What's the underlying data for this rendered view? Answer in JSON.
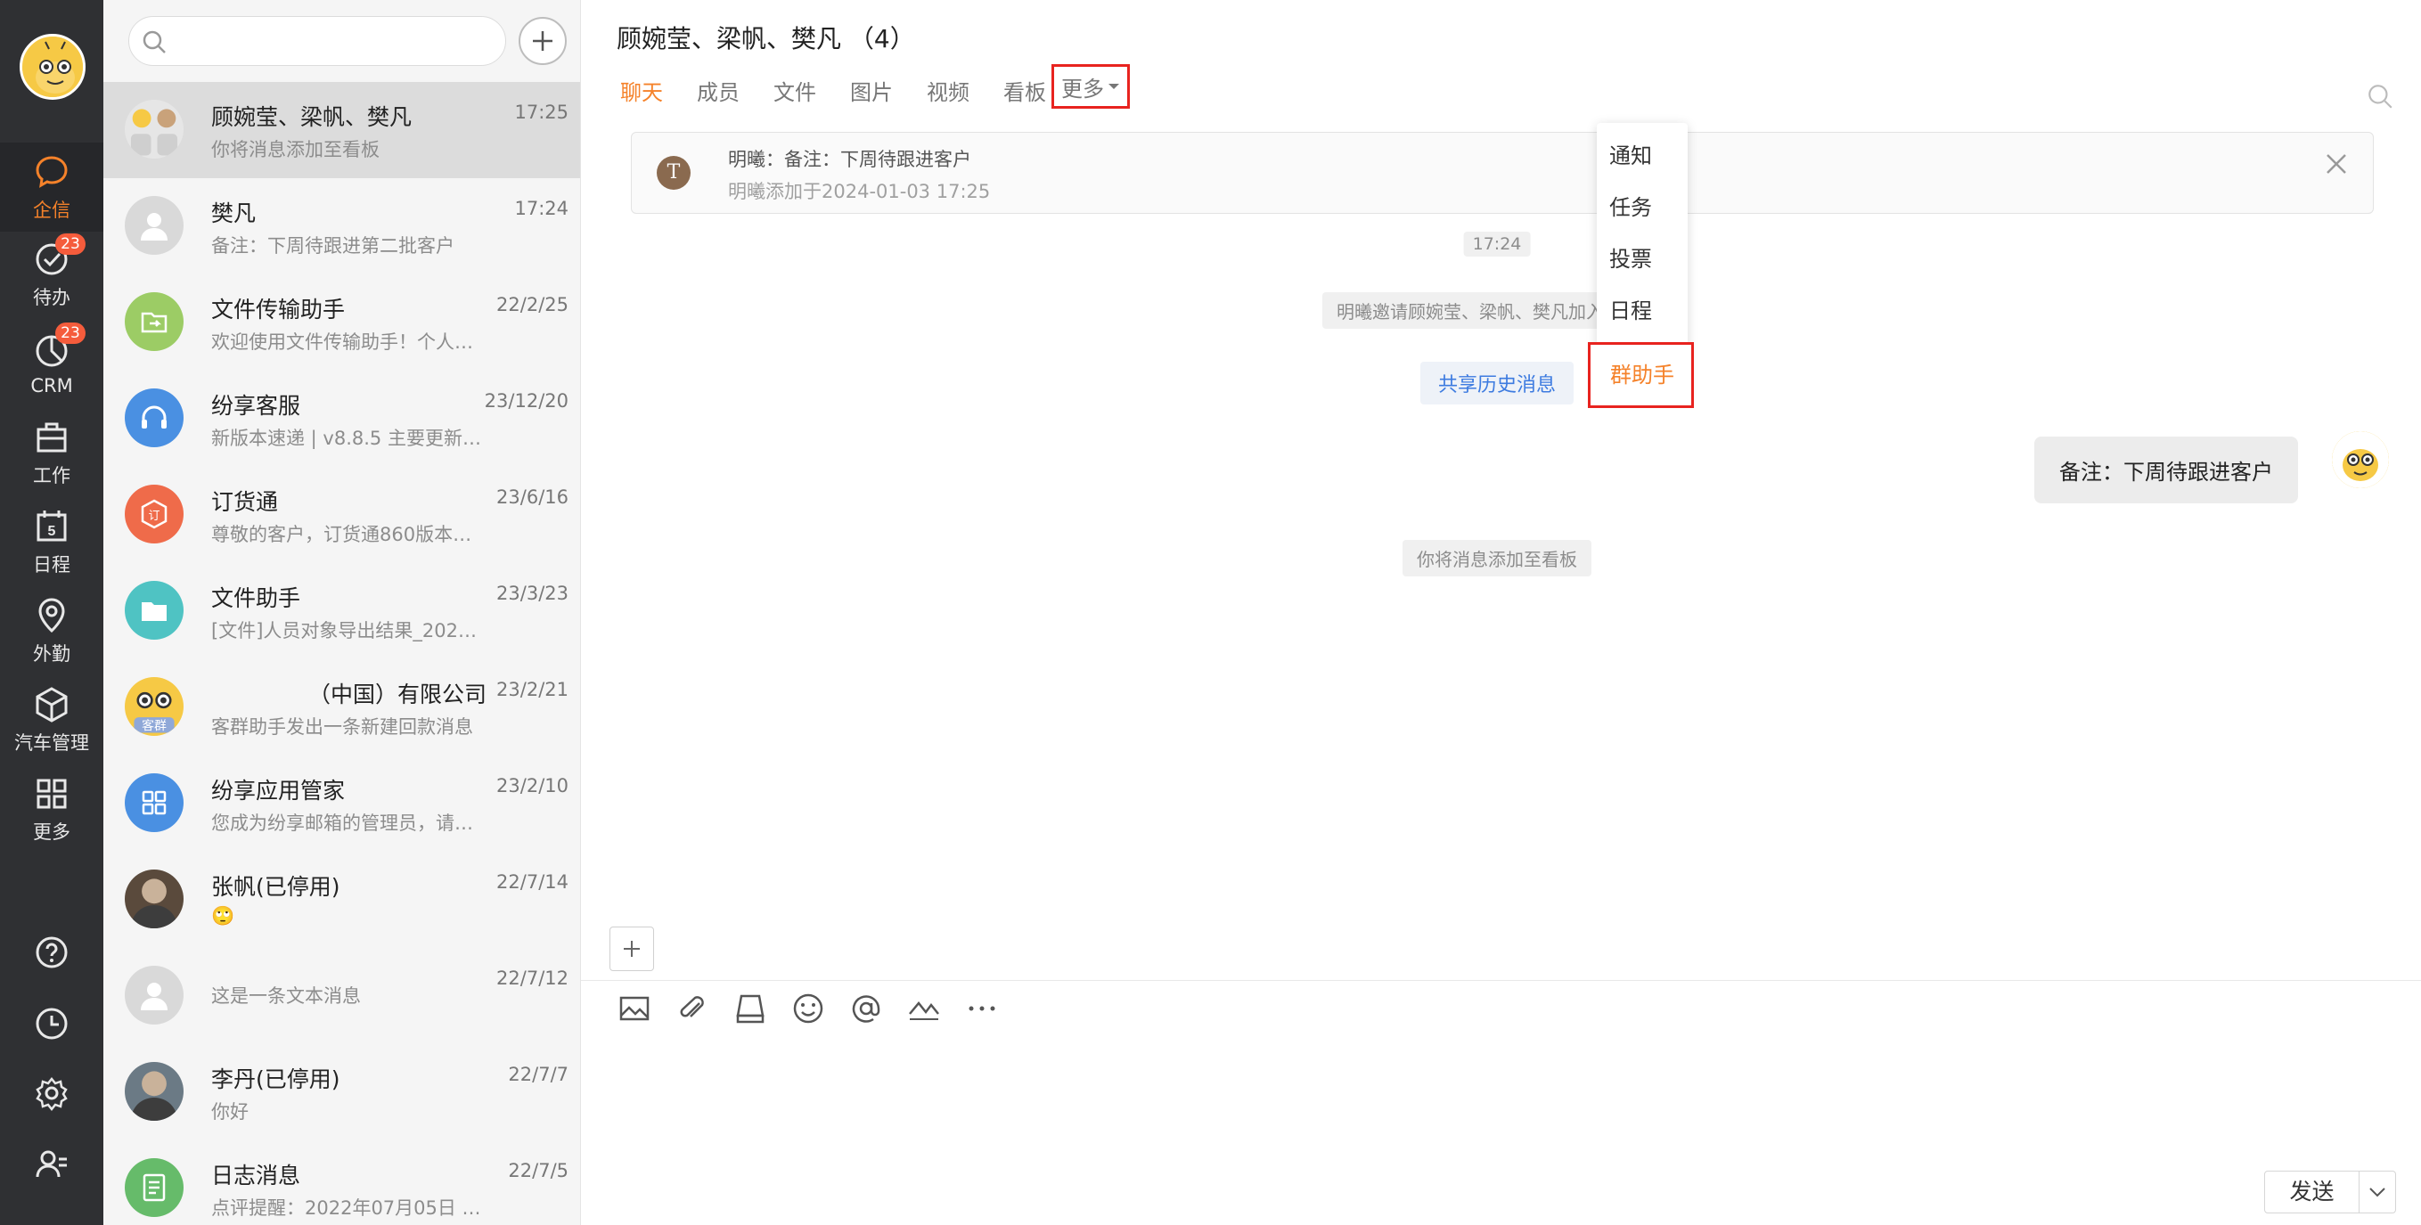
{
  "nav": {
    "items": [
      {
        "label": "企信",
        "icon": "chat-bubble-icon",
        "active": true
      },
      {
        "label": "待办",
        "icon": "check-circle-icon",
        "badge": "23"
      },
      {
        "label": "CRM",
        "icon": "pie-chart-icon",
        "badge": "23"
      },
      {
        "label": "工作",
        "icon": "briefcase-icon"
      },
      {
        "label": "日程",
        "icon": "calendar-icon",
        "day": "5"
      },
      {
        "label": "外勤",
        "icon": "location-pin-icon"
      },
      {
        "label": "汽车管理",
        "icon": "cube-icon"
      },
      {
        "label": "更多",
        "icon": "grid-icon"
      }
    ],
    "bottom_icons": [
      "help-icon",
      "clock-icon",
      "settings-icon",
      "contacts-icon"
    ]
  },
  "search": {
    "placeholder": ""
  },
  "conversations": [
    {
      "name": "顾婉莹、梁帆、樊凡",
      "time": "17:25",
      "preview": "你将消息添加至看板",
      "avatar": "group-avatar",
      "color": "#e6e6e6"
    },
    {
      "name": "樊凡",
      "time": "17:24",
      "preview": "备注：下周待跟进第二批客户",
      "avatar": "default-user-avatar",
      "color": "#d9d9d9"
    },
    {
      "name": "文件传输助手",
      "time": "22/2/25",
      "preview": "欢迎使用文件传输助手！个人…",
      "avatar": "file-transfer-icon",
      "color": "#9ccc65"
    },
    {
      "name": "纷享客服",
      "time": "23/12/20",
      "preview": "新版本速递 | v8.8.5 主要更新…",
      "avatar": "headset-icon",
      "color": "#4a90e2"
    },
    {
      "name": "订货通",
      "time": "23/6/16",
      "preview": "尊敬的客户，订货通860版本…",
      "avatar": "order-icon",
      "color": "#ef6b4a"
    },
    {
      "name": "文件助手",
      "time": "23/3/23",
      "preview": "[文件]人员对象导出结果_202…",
      "avatar": "folder-icon",
      "color": "#4fc3c3"
    },
    {
      "name": "（中国）有限公司",
      "time": "23/2/21",
      "preview": "客群助手发出一条新建回款消息",
      "avatar": "bee-group-avatar",
      "color": "#f6c945"
    },
    {
      "name": "纷享应用管家",
      "time": "23/2/10",
      "preview": "您成为纷享邮箱的管理员，请…",
      "avatar": "apps-grid-icon",
      "color": "#4a90e2"
    },
    {
      "name": "张帆(已停用)",
      "time": "22/7/14",
      "preview": "🙄",
      "avatar": "photo-avatar",
      "color": "#5a4a3c"
    },
    {
      "name": "",
      "time": "22/7/12",
      "preview": "这是一条文本消息",
      "avatar": "default-user-avatar",
      "color": "#d9d9d9"
    },
    {
      "name": "李丹(已停用)",
      "time": "22/7/7",
      "preview": "你好",
      "avatar": "photo-avatar",
      "color": "#6b7a85"
    },
    {
      "name": "日志消息",
      "time": "22/7/5",
      "preview": "点评提醒：2022年07月05日 …",
      "avatar": "log-icon",
      "color": "#66bb6a"
    }
  ],
  "chat": {
    "title": "顾婉莹、梁帆、樊凡 （4）",
    "tabs": [
      "聊天",
      "成员",
      "文件",
      "图片",
      "视频",
      "看板"
    ],
    "more_label": "更多",
    "pin": {
      "avatar_letter": "T",
      "text": "明曦：备注：下周待跟进客户",
      "sub": "明曦添加于2024-01-03 17:25"
    },
    "time_divider": "17:24",
    "invite_msg": "明曦邀请顾婉莹、梁帆、樊凡加入群对话",
    "share_history": "共享历史消息",
    "bubble": "备注：下周待跟进客户",
    "board_msg": "你将消息添加至看板",
    "dropdown": [
      "通知",
      "任务",
      "投票",
      "日程",
      "群助手"
    ],
    "send_label": "发送",
    "composer_placeholder": ""
  }
}
